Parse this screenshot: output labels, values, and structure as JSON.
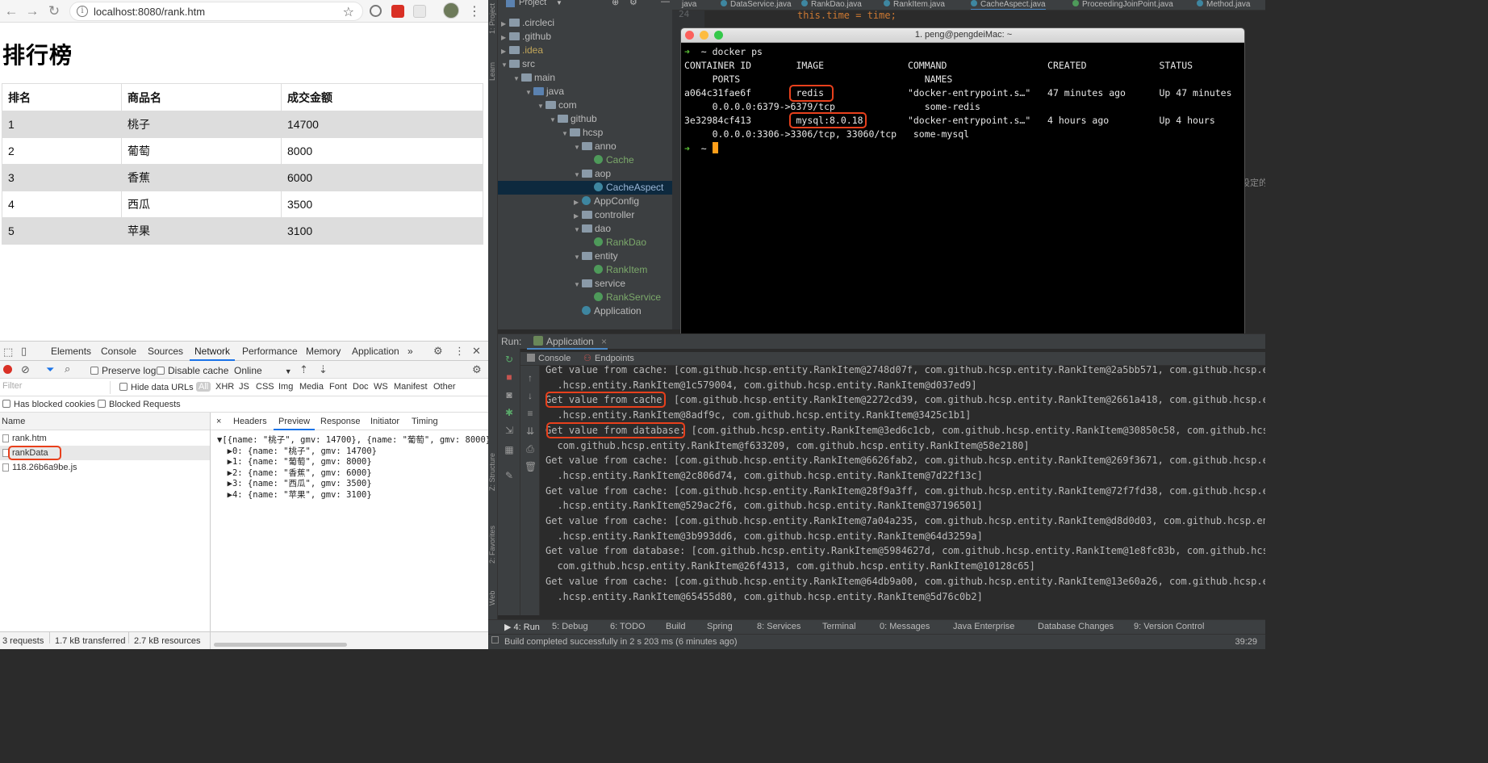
{
  "browser": {
    "url": "localhost:8080/rank.htm",
    "page_title": "排行榜",
    "table": {
      "headers": [
        "排名",
        "商品名",
        "成交金额"
      ],
      "rows": [
        [
          "1",
          "桃子",
          "14700"
        ],
        [
          "2",
          "葡萄",
          "8000"
        ],
        [
          "3",
          "香蕉",
          "6000"
        ],
        [
          "4",
          "西瓜",
          "3500"
        ],
        [
          "5",
          "苹果",
          "3100"
        ]
      ]
    },
    "devtools": {
      "tabs": [
        "Elements",
        "Console",
        "Sources",
        "Network",
        "Performance",
        "Memory",
        "Application",
        "»"
      ],
      "active_tab": "Network",
      "preserve_log": "Preserve log",
      "disable_cache": "Disable cache",
      "throttle": "Online",
      "filter_placeholder": "Filter",
      "hide_data_urls": "Hide data URLs",
      "types": [
        "All",
        "XHR",
        "JS",
        "CSS",
        "Img",
        "Media",
        "Font",
        "Doc",
        "WS",
        "Manifest",
        "Other"
      ],
      "has_blocked_cookies": "Has blocked cookies",
      "blocked_requests": "Blocked Requests",
      "name_header": "Name",
      "requests": [
        "rank.htm",
        "rankData",
        "118.26b6a9be.js"
      ],
      "detail_tabs": [
        "×",
        "Headers",
        "Preview",
        "Response",
        "Initiator",
        "Timing"
      ],
      "preview_lines": [
        "▼[{name: \"桃子\", gmv: 14700}, {name: \"葡萄\", gmv: 8000},",
        "  ▶0: {name: \"桃子\", gmv: 14700}",
        "  ▶1: {name: \"葡萄\", gmv: 8000}",
        "  ▶2: {name: \"香蕉\", gmv: 6000}",
        "  ▶3: {name: \"西瓜\", gmv: 3500}",
        "  ▶4: {name: \"苹果\", gmv: 3100}"
      ],
      "status": {
        "requests": "3 requests",
        "transferred": "1.7 kB transferred",
        "resources": "2.7 kB resources"
      }
    }
  },
  "ide": {
    "project_label": "Project",
    "editor_tabs": [
      "java",
      "DataService.java",
      "RankDao.java",
      "RankItem.java",
      "CacheAspect.java",
      "ProceedingJoinPoint.java",
      "Method.java"
    ],
    "active_editor_tab": "CacheAspect.java",
    "editor_line_number": "24",
    "editor_code": "this.time = time;",
    "editor_side_text": "设定的",
    "tree": [
      {
        "label": ".circleci",
        "indent": 0,
        "kind": "folder",
        "arrow": "▶"
      },
      {
        "label": ".github",
        "indent": 0,
        "kind": "folder",
        "arrow": "▶"
      },
      {
        "label": ".idea",
        "indent": 0,
        "kind": "folder-yellow",
        "arrow": "▶"
      },
      {
        "label": "src",
        "indent": 0,
        "kind": "folder",
        "arrow": "▼"
      },
      {
        "label": "main",
        "indent": 1,
        "kind": "folder",
        "arrow": "▼"
      },
      {
        "label": "java",
        "indent": 2,
        "kind": "folder-blue",
        "arrow": "▼"
      },
      {
        "label": "com",
        "indent": 3,
        "kind": "folder",
        "arrow": "▼"
      },
      {
        "label": "github",
        "indent": 4,
        "kind": "folder",
        "arrow": "▼"
      },
      {
        "label": "hcsp",
        "indent": 5,
        "kind": "folder",
        "arrow": "▼"
      },
      {
        "label": "anno",
        "indent": 6,
        "kind": "folder",
        "arrow": "▼"
      },
      {
        "label": "Cache",
        "indent": 7,
        "kind": "class-green",
        "arrow": ""
      },
      {
        "label": "aop",
        "indent": 6,
        "kind": "folder",
        "arrow": "▼"
      },
      {
        "label": "CacheAspect",
        "indent": 7,
        "kind": "class-sel",
        "arrow": ""
      },
      {
        "label": "AppConfig",
        "indent": 6,
        "kind": "class",
        "arrow": "▶"
      },
      {
        "label": "controller",
        "indent": 6,
        "kind": "folder",
        "arrow": "▶"
      },
      {
        "label": "dao",
        "indent": 6,
        "kind": "folder",
        "arrow": "▼"
      },
      {
        "label": "RankDao",
        "indent": 7,
        "kind": "class-green",
        "arrow": ""
      },
      {
        "label": "entity",
        "indent": 6,
        "kind": "folder",
        "arrow": "▼"
      },
      {
        "label": "RankItem",
        "indent": 7,
        "kind": "class-green",
        "arrow": ""
      },
      {
        "label": "service",
        "indent": 6,
        "kind": "folder",
        "arrow": "▼"
      },
      {
        "label": "RankService",
        "indent": 7,
        "kind": "class-green",
        "arrow": ""
      },
      {
        "label": "Application",
        "indent": 6,
        "kind": "class",
        "arrow": ""
      }
    ],
    "terminal": {
      "title": "1. peng@pengdeiMac: ~",
      "lines": [
        "~ docker ps",
        "CONTAINER ID        IMAGE               COMMAND                  CREATED             STATUS",
        "     PORTS                                 NAMES",
        "a064c31fae6f        redis               \"docker-entrypoint.s…\"   47 minutes ago      Up 47 minutes",
        "     0.0.0.0:6379->6379/tcp                some-redis",
        "3e32984cf413        mysql:8.0.18        \"docker-entrypoint.s…\"   4 hours ago         Up 4 hours",
        "     0.0.0.0:3306->3306/tcp, 33060/tcp   some-mysql",
        "~ "
      ]
    },
    "run": {
      "label": "Run:",
      "config": "Application",
      "console_tab": "Console",
      "endpoints_tab": "Endpoints",
      "lines": [
        "Get value from cache: [com.github.hcsp.entity.RankItem@2748d07f, com.github.hcsp.entity.RankItem@2a5bb571, com.github.hcsp.entity.Ra",
        "  .hcsp.entity.RankItem@1c579004, com.github.hcsp.entity.RankItem@d037ed9]",
        "Get value from cache: [com.github.hcsp.entity.RankItem@2272cd39, com.github.hcsp.entity.RankItem@2661a418, com.github.hcsp.entity.R",
        "  .hcsp.entity.RankItem@8adf9c, com.github.hcsp.entity.RankItem@3425c1b1]",
        "Get value from database: [com.github.hcsp.entity.RankItem@3ed6c1cb, com.github.hcsp.entity.RankItem@30850c58, com.github.hcsp.entit",
        "  com.github.hcsp.entity.RankItem@f633209, com.github.hcsp.entity.RankItem@58e2180]",
        "Get value from cache: [com.github.hcsp.entity.RankItem@6626fab2, com.github.hcsp.entity.RankItem@269f3671, com.github.hcsp.entity.R",
        "  .hcsp.entity.RankItem@2c806d74, com.github.hcsp.entity.RankItem@7d22f13c]",
        "Get value from cache: [com.github.hcsp.entity.RankItem@28f9a3ff, com.github.hcsp.entity.RankItem@72f7fd38, com.github.hcsp.entity.R",
        "  .hcsp.entity.RankItem@529ac2f6, com.github.hcsp.entity.RankItem@37196501]",
        "Get value from cache: [com.github.hcsp.entity.RankItem@7a04a235, com.github.hcsp.entity.RankItem@d8d0d03, com.github.hcsp.entity.Ra",
        "  .hcsp.entity.RankItem@3b993dd6, com.github.hcsp.entity.RankItem@64d3259a]",
        "Get value from database: [com.github.hcsp.entity.RankItem@5984627d, com.github.hcsp.entity.RankItem@1e8fc83b, com.github.hcsp.entit",
        "  com.github.hcsp.entity.RankItem@26f4313, com.github.hcsp.entity.RankItem@10128c65]",
        "Get value from cache: [com.github.hcsp.entity.RankItem@64db9a00, com.github.hcsp.entity.RankItem@13e60a26, com.github.hcsp.entity.R",
        "  .hcsp.entity.RankItem@65455d80, com.github.hcsp.entity.RankItem@5d76c0b2]"
      ]
    },
    "bottom_tools": [
      "▶ 4: Run",
      "5: Debug",
      "6: TODO",
      "Build",
      "Spring",
      "8: Services",
      "Terminal",
      "0: Messages",
      "Java Enterprise",
      "Database Changes",
      "9: Version Control"
    ],
    "status_text": "Build completed successfully in 2 s 203 ms (6 minutes ago)",
    "status_right": "39:29",
    "side_labels": [
      "1: Project",
      "Learn",
      "Z: Structure",
      "2: Favorites",
      "Web"
    ]
  },
  "colors": {
    "highlight_red": "#e8401c",
    "terminal_prompt": "#5bc236",
    "cursor": "#ff9f1a",
    "selected_tree_bg": "#0d293e"
  }
}
